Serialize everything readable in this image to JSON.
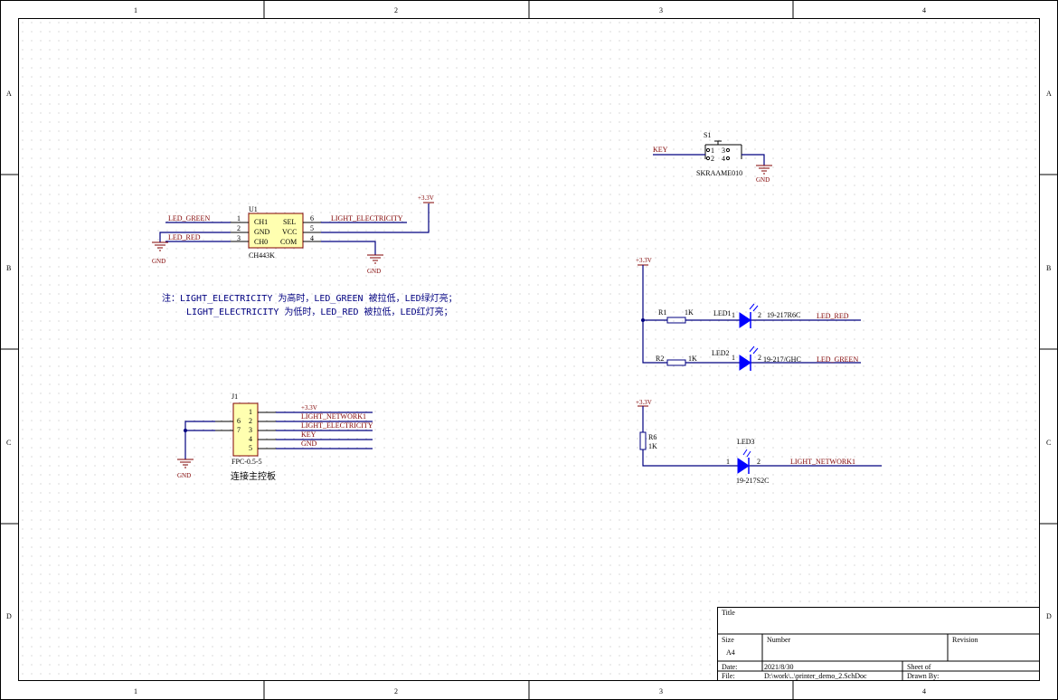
{
  "border": {
    "columns": [
      "1",
      "2",
      "3",
      "4"
    ],
    "rows": [
      "A",
      "B",
      "C",
      "D"
    ]
  },
  "power": {
    "vcc": "+3.3V",
    "gnd": "GND"
  },
  "u1": {
    "designator": "U1",
    "part": "CH443K",
    "left_pins": [
      {
        "name": "CH1",
        "num": "1",
        "net": "LED_GREEN"
      },
      {
        "name": "GND",
        "num": "2",
        "net": ""
      },
      {
        "name": "CH0",
        "num": "3",
        "net": "LED_RED"
      }
    ],
    "right_pins": [
      {
        "name": "SEL",
        "num": "6",
        "net": "LIGHT_ELECTRICITY"
      },
      {
        "name": "VCC",
        "num": "5",
        "net": ""
      },
      {
        "name": "COM",
        "num": "4",
        "net": ""
      }
    ]
  },
  "note": {
    "line1": "注：LIGHT_ELECTRICITY 为高时，LED_GREEN 被拉低，LED绿灯亮；",
    "line2": "LIGHT_ELECTRICITY 为低时，LED_RED 被拉低，LED红灯亮；"
  },
  "j1": {
    "designator": "J1",
    "part": "FPC-0.5-5",
    "caption": "连接主控板",
    "pins": [
      {
        "num": "1",
        "net": "+3.3V"
      },
      {
        "num": "2",
        "net": "LIGHT_NETWORK1"
      },
      {
        "num": "3",
        "net": "LIGHT_ELECTRICITY"
      },
      {
        "num": "4",
        "net": "KEY"
      },
      {
        "num": "5",
        "net": "GND"
      }
    ],
    "shield_pins": [
      "6",
      "7"
    ]
  },
  "s1": {
    "designator": "S1",
    "part": "SKRAAME010",
    "net": "KEY",
    "pins": [
      "1",
      "2",
      "3",
      "4"
    ]
  },
  "r1": {
    "designator": "R1",
    "value": "1K"
  },
  "r2": {
    "designator": "R2",
    "value": "1K"
  },
  "r6": {
    "designator": "R6",
    "value": "1K"
  },
  "led1": {
    "designator": "LED1",
    "part": "19-217R6C",
    "net": "LED_RED",
    "pin_a": "1",
    "pin_k": "2"
  },
  "led2": {
    "designator": "LED2",
    "part": "19-217/GHC",
    "net": "LED_GREEN",
    "pin_a": "1",
    "pin_k": "2"
  },
  "led3": {
    "designator": "LED3",
    "part": "19-217S2C",
    "net": "LIGHT_NETWORK1",
    "pin_a": "1",
    "pin_k": "2"
  },
  "title_block": {
    "title_label": "Title",
    "size_label": "Size",
    "size_value": "A4",
    "number_label": "Number",
    "revision_label": "Revision",
    "date_label": "Date:",
    "date_value": "2021/8/30",
    "sheet_label": "Sheet    of",
    "file_label": "File:",
    "file_value": "D:\\work\\..\\printer_demo_2.SchDoc",
    "drawn_label": "Drawn By:"
  }
}
